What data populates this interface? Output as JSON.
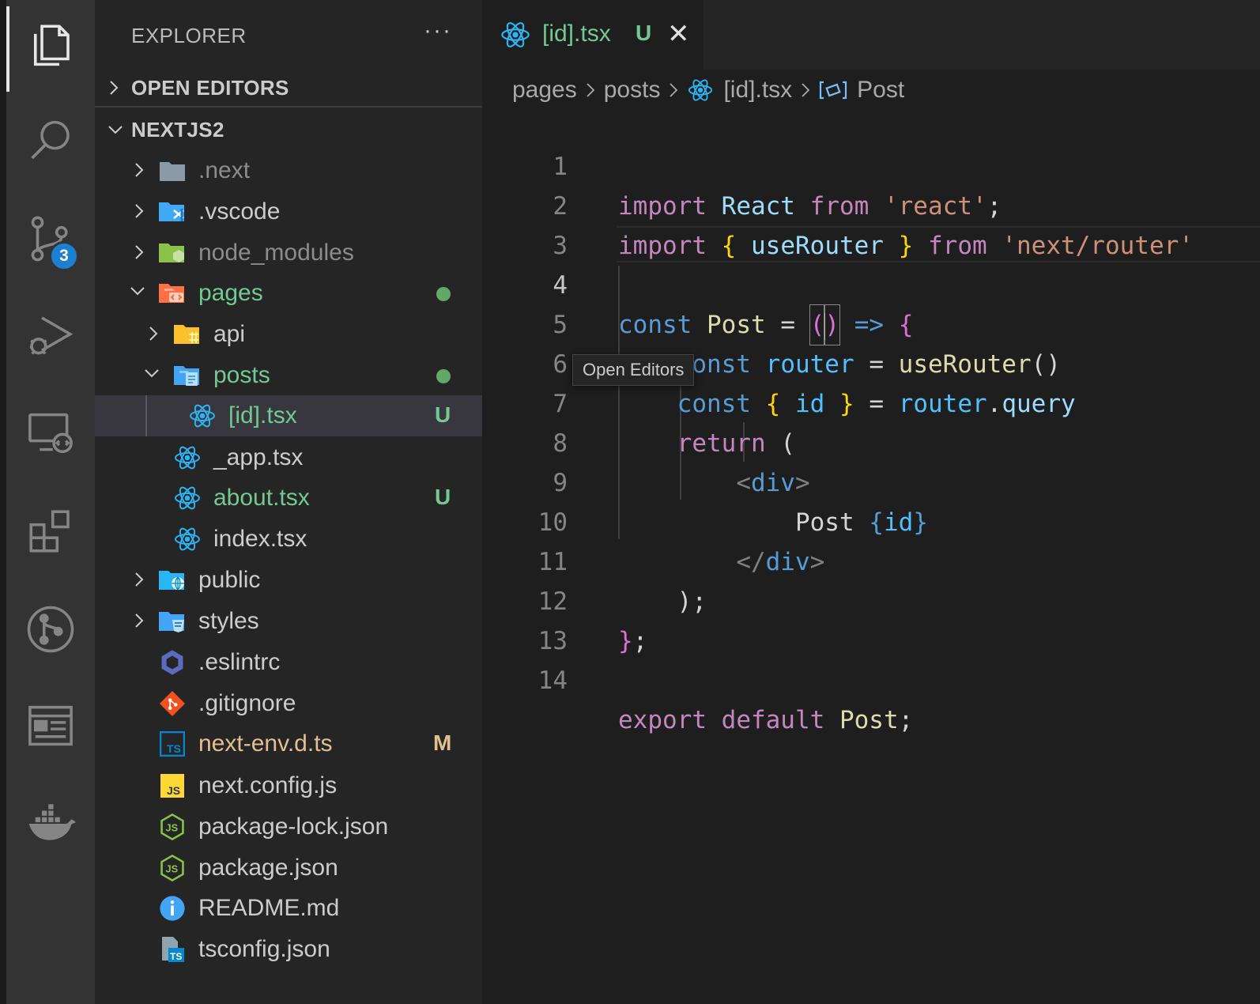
{
  "activity_bar": {
    "items": [
      {
        "name": "explorer",
        "icon": "files-icon",
        "active": true
      },
      {
        "name": "search",
        "icon": "search-icon"
      },
      {
        "name": "source-control",
        "icon": "source-control-icon",
        "badge": "3"
      },
      {
        "name": "run-debug",
        "icon": "run-debug-icon"
      },
      {
        "name": "remote-explorer",
        "icon": "remote-explorer-icon"
      },
      {
        "name": "extensions",
        "icon": "extensions-icon"
      },
      {
        "name": "git-graph",
        "icon": "git-graph-icon"
      },
      {
        "name": "preview",
        "icon": "preview-icon"
      },
      {
        "name": "docker",
        "icon": "docker-icon"
      }
    ]
  },
  "sidebar": {
    "title": "EXPLORER",
    "more": "···",
    "open_editors": "OPEN EDITORS",
    "workspace": "NEXTJS2",
    "tree": [
      {
        "label": ".next",
        "icon": "folder-icon",
        "color": "dim"
      },
      {
        "label": ".vscode",
        "icon": "vscode-folder-icon"
      },
      {
        "label": "node_modules",
        "icon": "node-folder-icon",
        "color": "dim"
      },
      {
        "label": "pages",
        "icon": "pages-folder-icon",
        "color": "green",
        "status": "dot"
      },
      {
        "label": "api",
        "icon": "api-folder-icon"
      },
      {
        "label": "posts",
        "icon": "posts-folder-icon",
        "color": "green",
        "status": "dot"
      },
      {
        "label": "[id].tsx",
        "icon": "react-icon",
        "color": "green",
        "status": "U"
      },
      {
        "label": "_app.tsx",
        "icon": "react-icon"
      },
      {
        "label": "about.tsx",
        "icon": "react-icon",
        "color": "green",
        "status": "U"
      },
      {
        "label": "index.tsx",
        "icon": "react-icon"
      },
      {
        "label": "public",
        "icon": "public-folder-icon"
      },
      {
        "label": "styles",
        "icon": "styles-folder-icon"
      },
      {
        "label": ".eslintrc",
        "icon": "eslint-icon"
      },
      {
        "label": ".gitignore",
        "icon": "git-icon"
      },
      {
        "label": "next-env.d.ts",
        "icon": "ts-file-icon",
        "color": "modified",
        "status": "M"
      },
      {
        "label": "next.config.js",
        "icon": "js-file-icon"
      },
      {
        "label": "package-lock.json",
        "icon": "nodejs-icon"
      },
      {
        "label": "package.json",
        "icon": "nodejs-icon"
      },
      {
        "label": "README.md",
        "icon": "info-icon"
      },
      {
        "label": "tsconfig.json",
        "icon": "tsconfig-icon"
      }
    ]
  },
  "editor": {
    "tab": {
      "label": "[id].tsx",
      "status": "U",
      "close": "✕"
    },
    "breadcrumbs": [
      "pages",
      "posts",
      "[id].tsx",
      "Post"
    ],
    "tooltip": "Open Editors",
    "active_line": 4,
    "line_numbers": [
      "1",
      "2",
      "3",
      "4",
      "5",
      "6",
      "7",
      "8",
      "9",
      "10",
      "11",
      "12",
      "13",
      "14"
    ],
    "code": {
      "l1": {
        "k1": "import",
        "k2": "React",
        "k3": "from",
        "k4": "'react'",
        "k5": ";"
      },
      "l2": {
        "k1": "import",
        "k2": "{",
        "k3": "useRouter",
        "k4": "}",
        "k5": "from",
        "k6": "'next/router'"
      },
      "l4": {
        "k1": "const",
        "k2": "Post",
        "k3": "=",
        "k4": "(",
        "k5": ")",
        "k6": "=>",
        "k7": "{"
      },
      "l5": {
        "k1": "const",
        "k2": "router",
        "k3": "=",
        "k4": "useRouter",
        "k5": "()"
      },
      "l6": {
        "k1": "const",
        "k2": "{",
        "k3": "id",
        "k4": "}",
        "k5": "=",
        "k6": "router",
        "k7": ".",
        "k8": "query"
      },
      "l7": {
        "k1": "return",
        "k2": "("
      },
      "l8": {
        "k1": "<",
        "k2": "div",
        "k3": ">"
      },
      "l9": {
        "k1": "Post",
        "k2": "{",
        "k3": "id",
        "k4": "}"
      },
      "l10": {
        "k1": "</",
        "k2": "div",
        "k3": ">"
      },
      "l11": {
        "k1": ")",
        "k2": ";"
      },
      "l12": {
        "k1": "}",
        "k2": ";"
      },
      "l14": {
        "k1": "export",
        "k2": "default",
        "k3": "Post",
        "k4": ";"
      }
    }
  }
}
